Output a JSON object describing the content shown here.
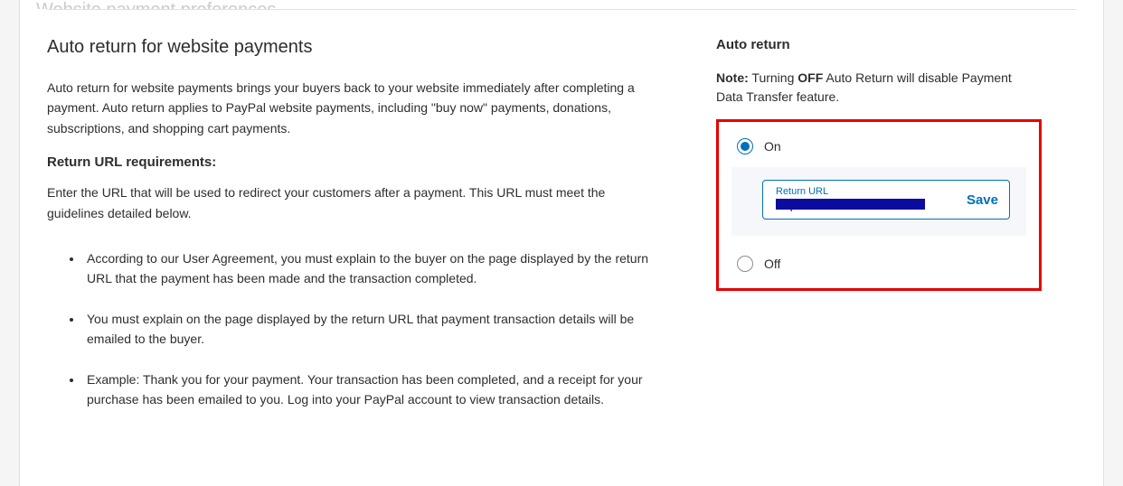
{
  "page": {
    "title_remnant": "Website payment preferences"
  },
  "left": {
    "section_title": "Auto return for website payments",
    "para1": "Auto return for website payments brings your buyers back to your website immediately after completing a payment. Auto return applies to PayPal website payments, including \"buy now\" payments, donations, subscriptions, and shopping cart payments.",
    "subheading": "Return URL requirements:",
    "para2": "Enter the URL that will be used to redirect your customers after a payment. This URL must meet the guidelines detailed below.",
    "bullets": [
      "According to our User Agreement, you must explain to the buyer on the page displayed by the return URL that the payment has been made and the transaction completed.",
      "You must explain on the page displayed by the return URL that payment transaction details will be emailed to the buyer.",
      "Example: Thank you for your payment. Your transaction has been completed, and a receipt for your purchase has been emailed to you. Log into your PayPal account to view transaction details."
    ]
  },
  "right": {
    "heading": "Auto return",
    "note_label": "Note:",
    "note_pre": " Turning ",
    "note_bold": "OFF",
    "note_post": " Auto Return will disable Payment Data Transfer feature.",
    "option_on": "On",
    "option_off": "Off",
    "input_label": "Return URL",
    "input_value": "https://127.0.0.1:8500/.",
    "save_label": "Save"
  }
}
